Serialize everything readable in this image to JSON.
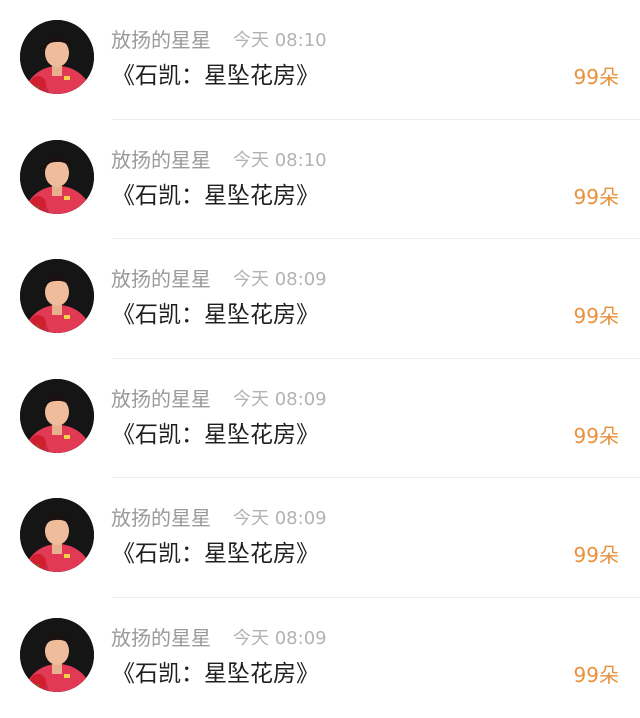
{
  "colors": {
    "username": "#9a9a9a",
    "time": "#b3b3b3",
    "message": "#1f1f1f",
    "gift": "#e9913d",
    "divider": "#ededed"
  },
  "list": {
    "items": [
      {
        "avatar": "player-avatar",
        "username": "放扬的星星",
        "time": "今天 08:10",
        "message": "《石凯：星坠花房》",
        "gift": "99朵"
      },
      {
        "avatar": "player-avatar",
        "username": "放扬的星星",
        "time": "今天 08:10",
        "message": "《石凯：星坠花房》",
        "gift": "99朵"
      },
      {
        "avatar": "player-avatar",
        "username": "放扬的星星",
        "time": "今天 08:09",
        "message": "《石凯：星坠花房》",
        "gift": "99朵"
      },
      {
        "avatar": "player-avatar",
        "username": "放扬的星星",
        "time": "今天 08:09",
        "message": "《石凯：星坠花房》",
        "gift": "99朵"
      },
      {
        "avatar": "player-avatar",
        "username": "放扬的星星",
        "time": "今天 08:09",
        "message": "《石凯：星坠花房》",
        "gift": "99朵"
      },
      {
        "avatar": "player-avatar",
        "username": "放扬的星星",
        "time": "今天 08:09",
        "message": "《石凯：星坠花房》",
        "gift": "99朵"
      }
    ]
  }
}
